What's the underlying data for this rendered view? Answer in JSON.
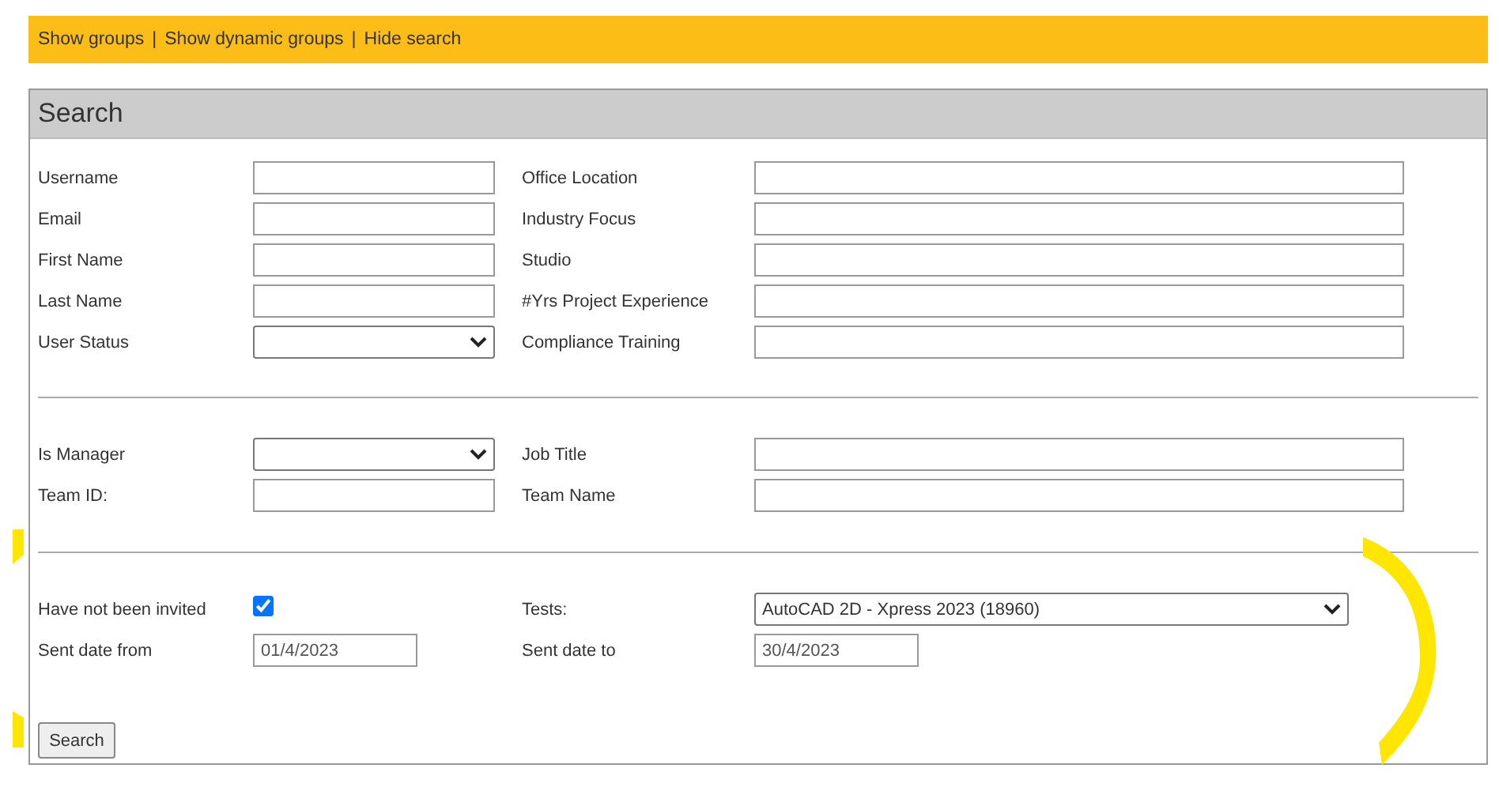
{
  "top_bar": {
    "links": [
      "Show groups",
      "Show dynamic groups",
      "Hide search"
    ],
    "separator": "|"
  },
  "panel": {
    "title": "Search",
    "sections": [
      {
        "rows": [
          {
            "left": {
              "label": "Username",
              "kind": "text"
            },
            "right": {
              "label": "Office Location",
              "kind": "text"
            }
          },
          {
            "left": {
              "label": "Email",
              "kind": "text"
            },
            "right": {
              "label": "Industry Focus",
              "kind": "text"
            }
          },
          {
            "left": {
              "label": "First Name",
              "kind": "text"
            },
            "right": {
              "label": "Studio",
              "kind": "text"
            }
          },
          {
            "left": {
              "label": "Last Name",
              "kind": "text"
            },
            "right": {
              "label": "#Yrs Project Experience",
              "kind": "text"
            }
          },
          {
            "left": {
              "label": "User Status",
              "kind": "select"
            },
            "right": {
              "label": "Compliance Training",
              "kind": "text"
            }
          }
        ]
      },
      {
        "rows": [
          {
            "left": {
              "label": "Is Manager",
              "kind": "select"
            },
            "right": {
              "label": "Job Title",
              "kind": "text"
            }
          },
          {
            "left": {
              "label": "Team ID:",
              "kind": "text"
            },
            "right": {
              "label": "Team Name",
              "kind": "text"
            }
          }
        ]
      },
      {
        "rows": [
          {
            "left": {
              "label": "Have not been invited",
              "kind": "checkbox",
              "checked": true
            },
            "right": {
              "label": "Tests:",
              "kind": "select",
              "value": "AutoCAD 2D - Xpress 2023 (18960)"
            }
          },
          {
            "left": {
              "label": "Sent date from",
              "kind": "date",
              "value": "01/4/2023"
            },
            "right": {
              "label": "Sent date to",
              "kind": "date",
              "value": "30/4/2023"
            }
          }
        ]
      }
    ],
    "button": "Search"
  }
}
